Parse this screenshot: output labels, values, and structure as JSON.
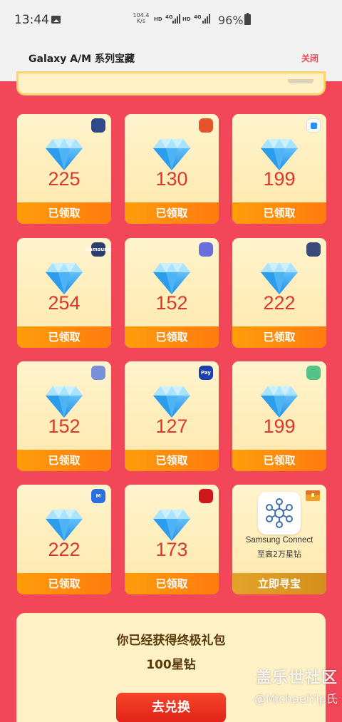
{
  "status_bar": {
    "time": "13:44",
    "speed_value": "104.4",
    "speed_unit": "K/s",
    "net1": "HD",
    "net2": "4G",
    "net3": "HD",
    "net4": "4G",
    "battery": "96%"
  },
  "header": {
    "title": "Galaxy A/M 系列宝藏",
    "close_label": "关闭"
  },
  "cards": [
    {
      "value": "225",
      "footer": "已领取",
      "badge_color": "#2f4a8a",
      "badge_icon": "bixby-icon"
    },
    {
      "value": "130",
      "footer": "已领取",
      "badge_color": "#e5542a",
      "badge_icon": "reminder-icon"
    },
    {
      "value": "199",
      "footer": "已领取",
      "badge_color": "#ffffff",
      "badge_icon": "secure-folder-icon"
    },
    {
      "value": "254",
      "footer": "已领取",
      "badge_color": "#2c3e6b",
      "badge_icon": "samsung-members-icon",
      "badge_text": "Samsung"
    },
    {
      "value": "152",
      "footer": "已领取",
      "badge_color": "#6b6fdc",
      "badge_icon": "internet-icon"
    },
    {
      "value": "222",
      "footer": "已领取",
      "badge_color": "#3a4a7a",
      "badge_icon": "clock-icon"
    },
    {
      "value": "152",
      "footer": "已领取",
      "badge_color": "#7b8fd8",
      "badge_icon": "sync-icon"
    },
    {
      "value": "127",
      "footer": "已领取",
      "badge_color": "#1d3fb0",
      "badge_icon": "pay-icon",
      "badge_text": "Pay"
    },
    {
      "value": "199",
      "footer": "已领取",
      "badge_color": "#54c38a",
      "badge_icon": "health-icon"
    },
    {
      "value": "222",
      "footer": "已领取",
      "badge_color": "#2b6fe0",
      "badge_icon": "m-app-icon",
      "badge_text": "M"
    },
    {
      "value": "173",
      "footer": "已领取",
      "badge_color": "#d0171b",
      "badge_icon": "music-icon"
    }
  ],
  "special_card": {
    "name": "Samsung Connect",
    "subtitle": "至高2万星钻",
    "button": "立即寻宝"
  },
  "bottom": {
    "title": "你已经获得终极礼包",
    "reward": "100星钻",
    "button": "去兑换"
  },
  "watermark": {
    "title": "盖乐世社区",
    "user": "@MichaelYip氏"
  }
}
